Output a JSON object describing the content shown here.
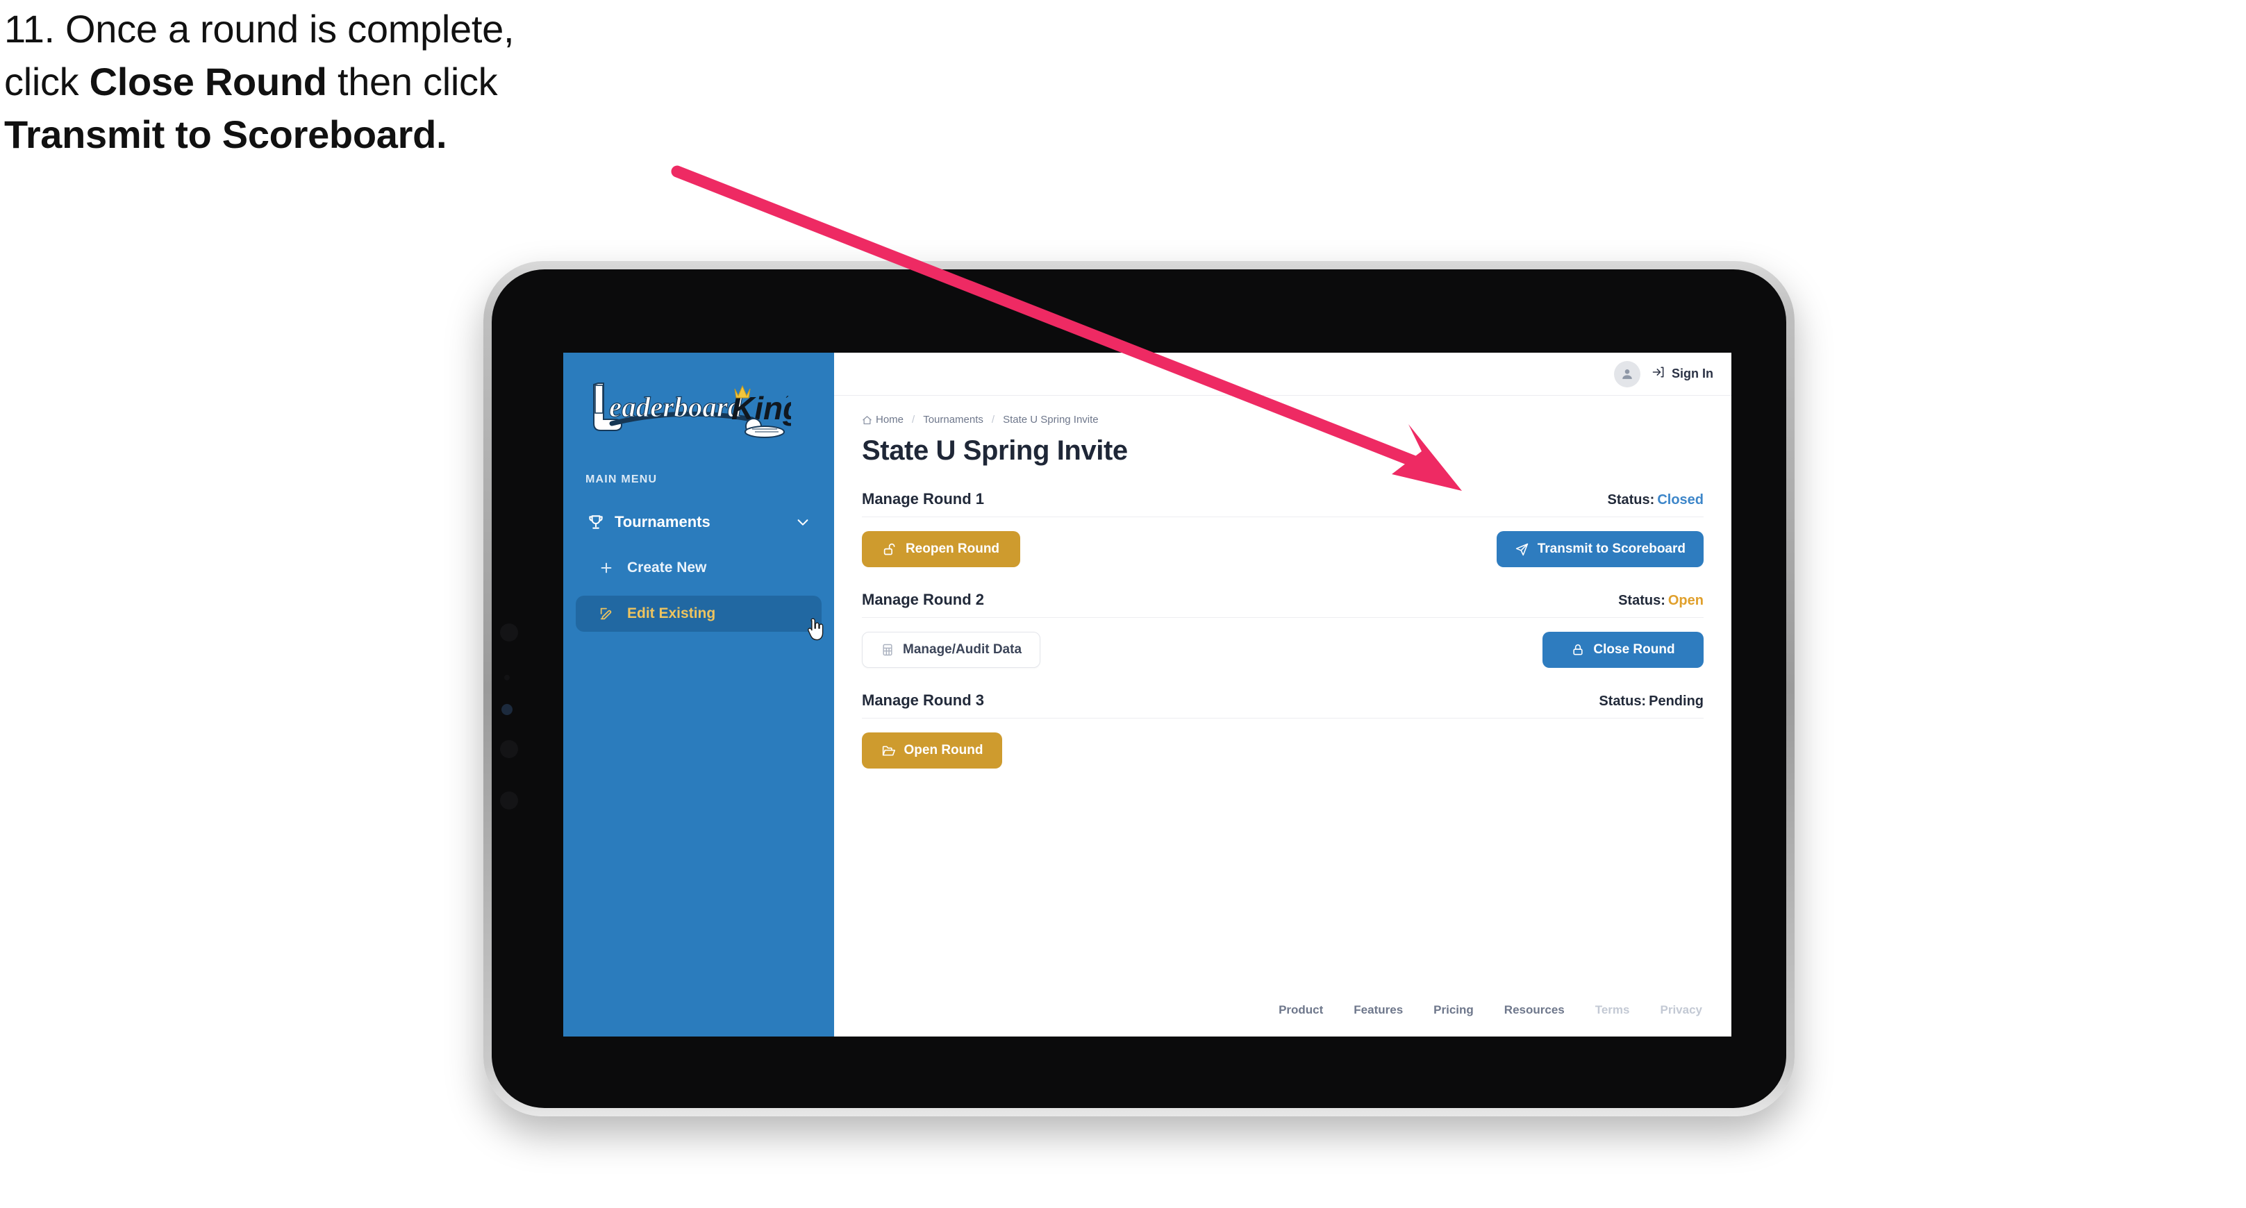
{
  "instruction": {
    "line1": "11. Once a round is complete,",
    "line2_pre": "click ",
    "line2_bold": "Close Round",
    "line2_post": " then click",
    "line3_bold": "Transmit to Scoreboard."
  },
  "annotation": {
    "arrow_color": "#ee2a63",
    "points_to": "Transmit to Scoreboard"
  },
  "app": {
    "brand": {
      "name_left": "Leaderboard",
      "name_right": "King",
      "icon": "golf-club-logo-icon"
    },
    "sidebar": {
      "section_label": "MAIN MENU",
      "items": [
        {
          "label": "Tournaments",
          "icon": "trophy-icon",
          "chevron": "chevron-down-icon",
          "active": false,
          "level": "top"
        },
        {
          "label": "Create New",
          "icon": "plus-icon",
          "active": false,
          "level": "sub"
        },
        {
          "label": "Edit Existing",
          "icon": "edit-pencil-icon",
          "active": true,
          "level": "sub"
        }
      ],
      "cursor": "hand-pointer-cursor",
      "bg_color": "#2b7cbd",
      "active_bg_color": "#2168a2",
      "active_text_color": "#eec45f"
    },
    "topbar": {
      "avatar_icon": "user-avatar-icon",
      "signin_icon": "sign-in-arrow-icon",
      "signin_label": "Sign In"
    },
    "breadcrumb": {
      "home_icon": "home-icon",
      "items": [
        "Home",
        "Tournaments",
        "State U Spring Invite"
      ],
      "separator": "/"
    },
    "page_title": "State U Spring Invite",
    "rounds": [
      {
        "name": "Manage Round 1",
        "status_label": "Status:",
        "status_value": "Closed",
        "status_color": "#3d86c9",
        "left_button": {
          "label": "Reopen Round",
          "icon": "unlock-icon",
          "style": "gold"
        },
        "right_button": {
          "label": "Transmit to Scoreboard",
          "icon": "paper-plane-icon",
          "style": "blue"
        }
      },
      {
        "name": "Manage Round 2",
        "status_label": "Status:",
        "status_value": "Open",
        "status_color": "#e0a02c",
        "left_button": {
          "label": "Manage/Audit Data",
          "icon": "table-grid-icon",
          "style": "ghost"
        },
        "right_button": {
          "label": "Close Round",
          "icon": "lock-icon",
          "style": "blue"
        }
      },
      {
        "name": "Manage Round 3",
        "status_label": "Status:",
        "status_value": "Pending",
        "status_color": "#222a3a",
        "left_button": {
          "label": "Open Round",
          "icon": "open-folder-icon",
          "style": "gold"
        },
        "right_button": null
      }
    ],
    "footer": {
      "links": [
        {
          "label": "Product",
          "dim": false
        },
        {
          "label": "Features",
          "dim": false
        },
        {
          "label": "Pricing",
          "dim": false
        },
        {
          "label": "Resources",
          "dim": false
        },
        {
          "label": "Terms",
          "dim": true
        },
        {
          "label": "Privacy",
          "dim": true
        }
      ]
    },
    "colors": {
      "gold": "#ce9b2e",
      "blue": "#2e7cbf",
      "sidebar_blue": "#2b7cbd",
      "text_dark": "#222a3a"
    }
  }
}
